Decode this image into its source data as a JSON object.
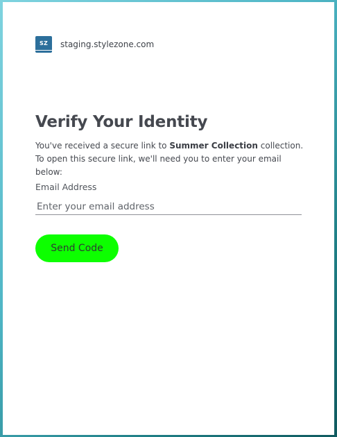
{
  "brand": {
    "logo_text": "SZ",
    "domain": "staging.stylezone.com"
  },
  "heading": {
    "title": "Verify Your Identity"
  },
  "description": {
    "prefix": "You've received a secure link to ",
    "collection_name": "Summer Collection",
    "suffix": " collection. To open this secure link, we'll need you to enter your email below:"
  },
  "form": {
    "email_label": "Email Address",
    "email_value": "",
    "email_placeholder": "Enter your email address",
    "submit_label": "Send Code"
  },
  "colors": {
    "button": "#0dff00",
    "logo": "#2c6f9b",
    "text": "#45484f"
  }
}
